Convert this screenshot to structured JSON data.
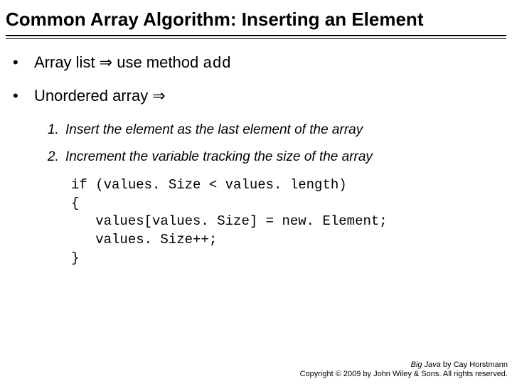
{
  "title": "Common Array Algorithm: Inserting an Element",
  "bullets": {
    "item1_pre": "Array list ⇒ use method ",
    "item1_code": "add",
    "item2": "Unordered array ⇒"
  },
  "steps": {
    "s1": "Insert the element as the last element of the array",
    "s2": "Increment the variable tracking the size of the array"
  },
  "code": "if (values. Size < values. length)\n{\n   values[values. Size] = new. Element;\n   values. Size++;\n}",
  "footer": {
    "line1_book": "Big Java",
    "line1_rest": " by Cay Horstmann",
    "line2": "Copyright © 2009 by John Wiley & Sons.  All rights reserved."
  }
}
